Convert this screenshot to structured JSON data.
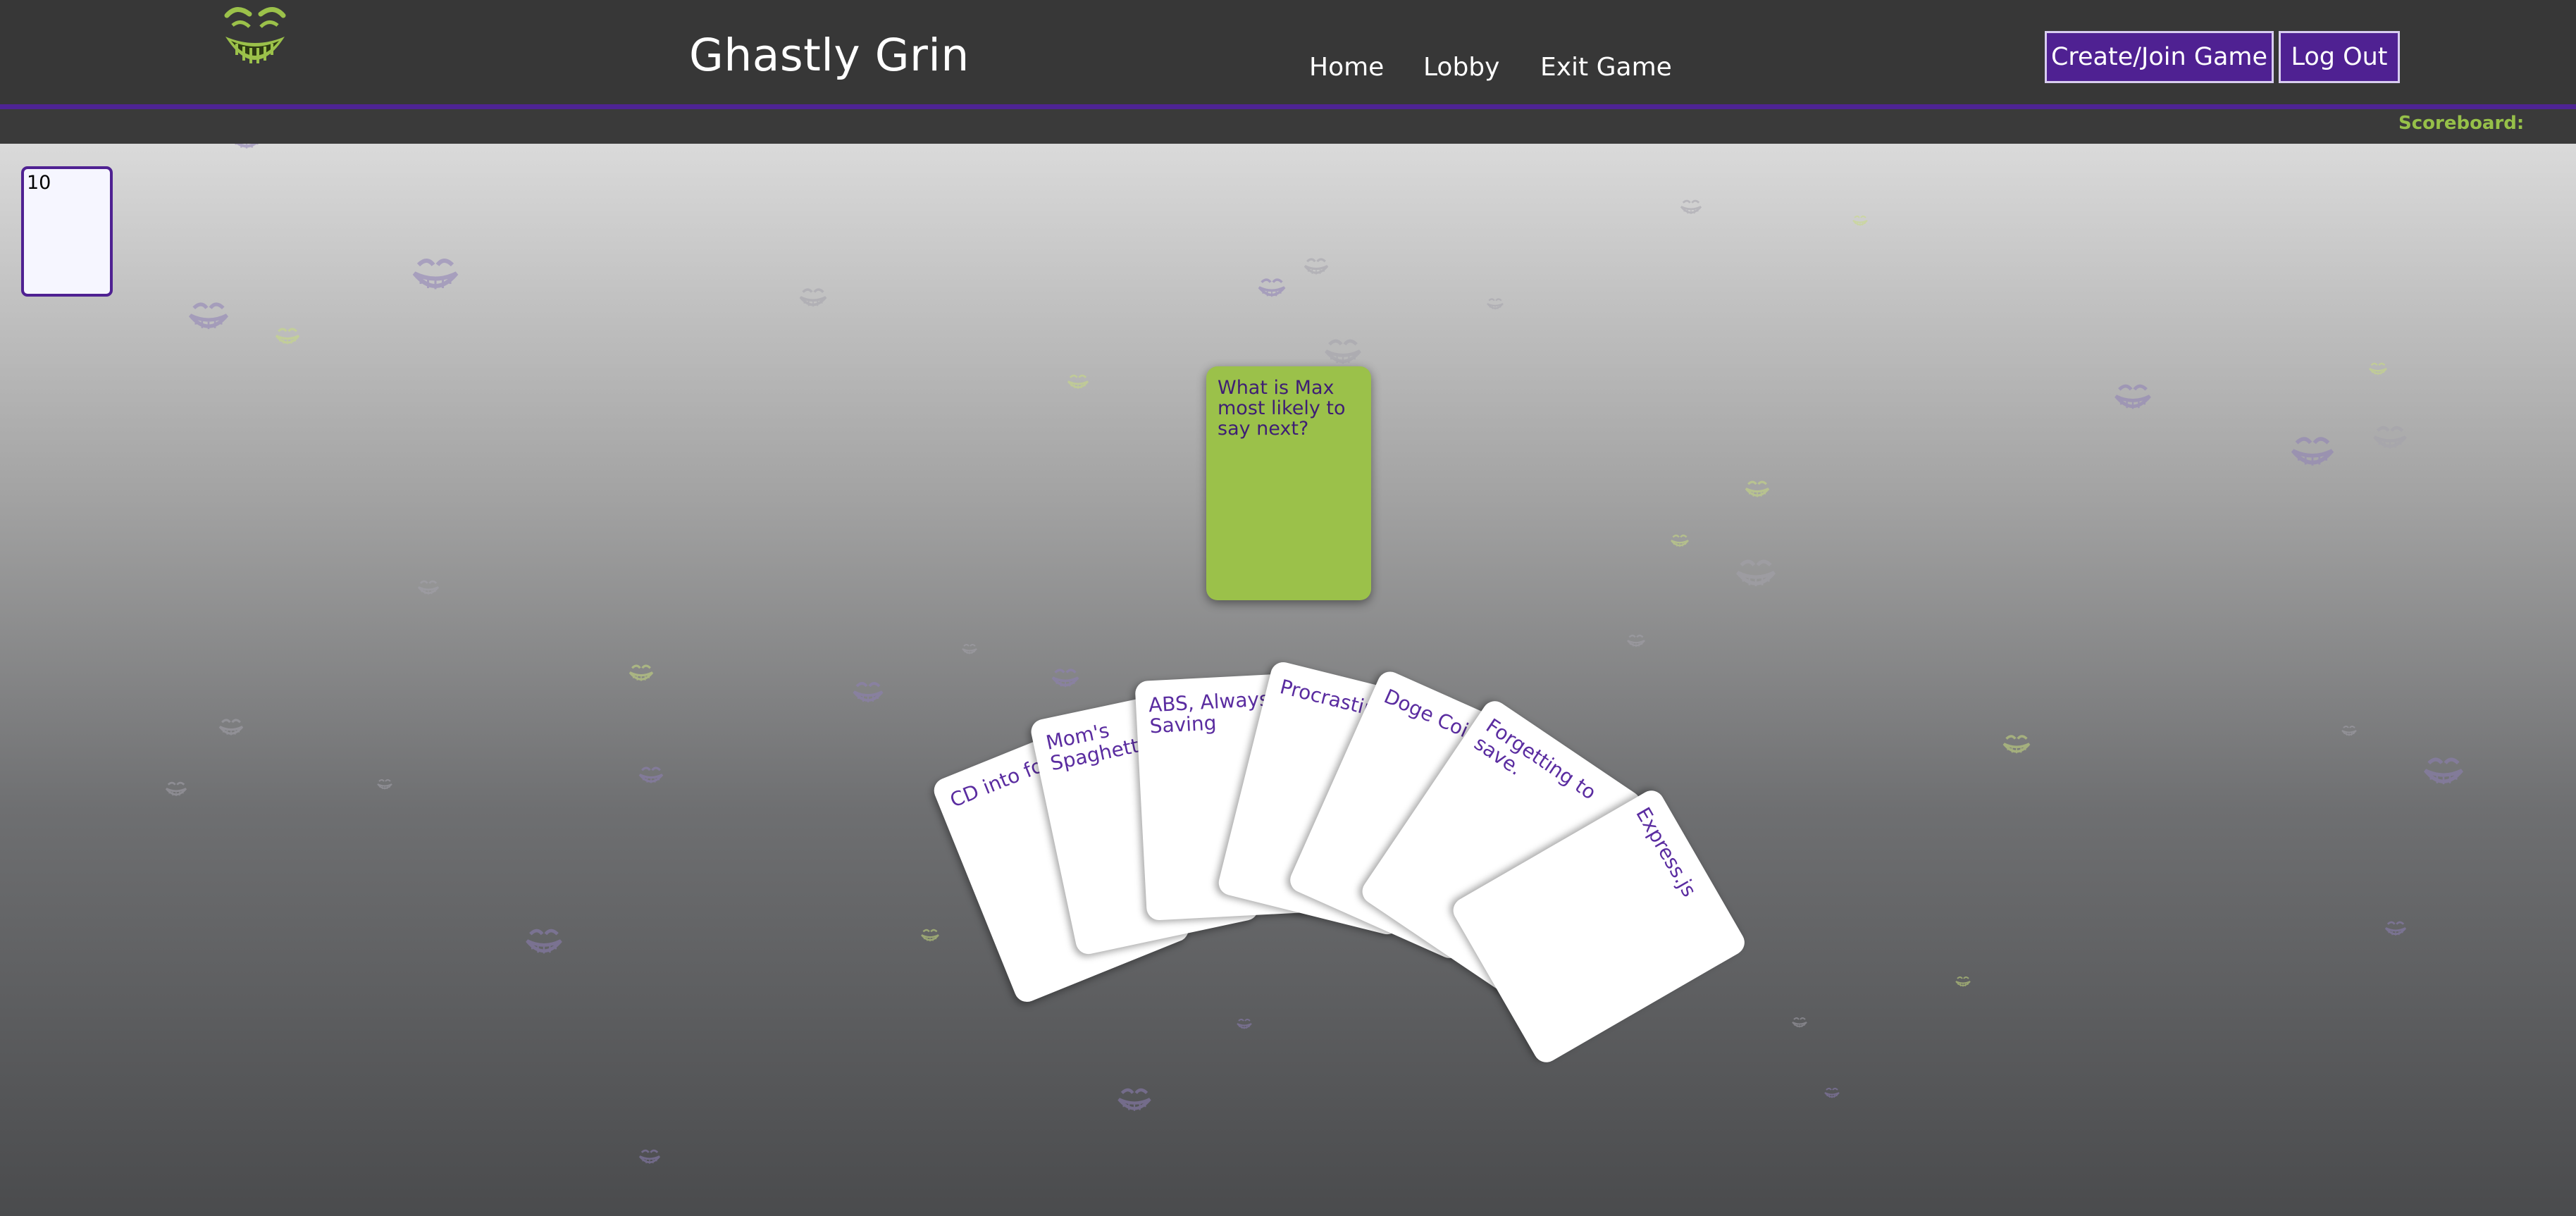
{
  "header": {
    "app_title": "Ghastly Grin",
    "logo_icon": "grinning-face-logo-icon",
    "nav": [
      {
        "label": "Home"
      },
      {
        "label": "Lobby"
      },
      {
        "label": "Exit Game"
      }
    ],
    "buttons": {
      "create_join": "Create/Join Game",
      "log_out": "Log Out"
    }
  },
  "scoreboard": {
    "label": "Scoreboard:"
  },
  "deck": {
    "count": "10"
  },
  "prompt_card": {
    "text": "What is Max most likely to say next?"
  },
  "hand": [
    {
      "text": "CD into folder."
    },
    {
      "text": "Mom's Spaghetti"
    },
    {
      "text": "ABS, Always Be Saving"
    },
    {
      "text": "Procrastination"
    },
    {
      "text": "Doge Coin"
    },
    {
      "text": "Forgetting to save."
    },
    {
      "text": "Express.js"
    }
  ],
  "colors": {
    "brand_purple": "#4f2192",
    "brand_green": "#9bc14a",
    "navbar": "#373737",
    "card_text": "#5a2ca0"
  }
}
